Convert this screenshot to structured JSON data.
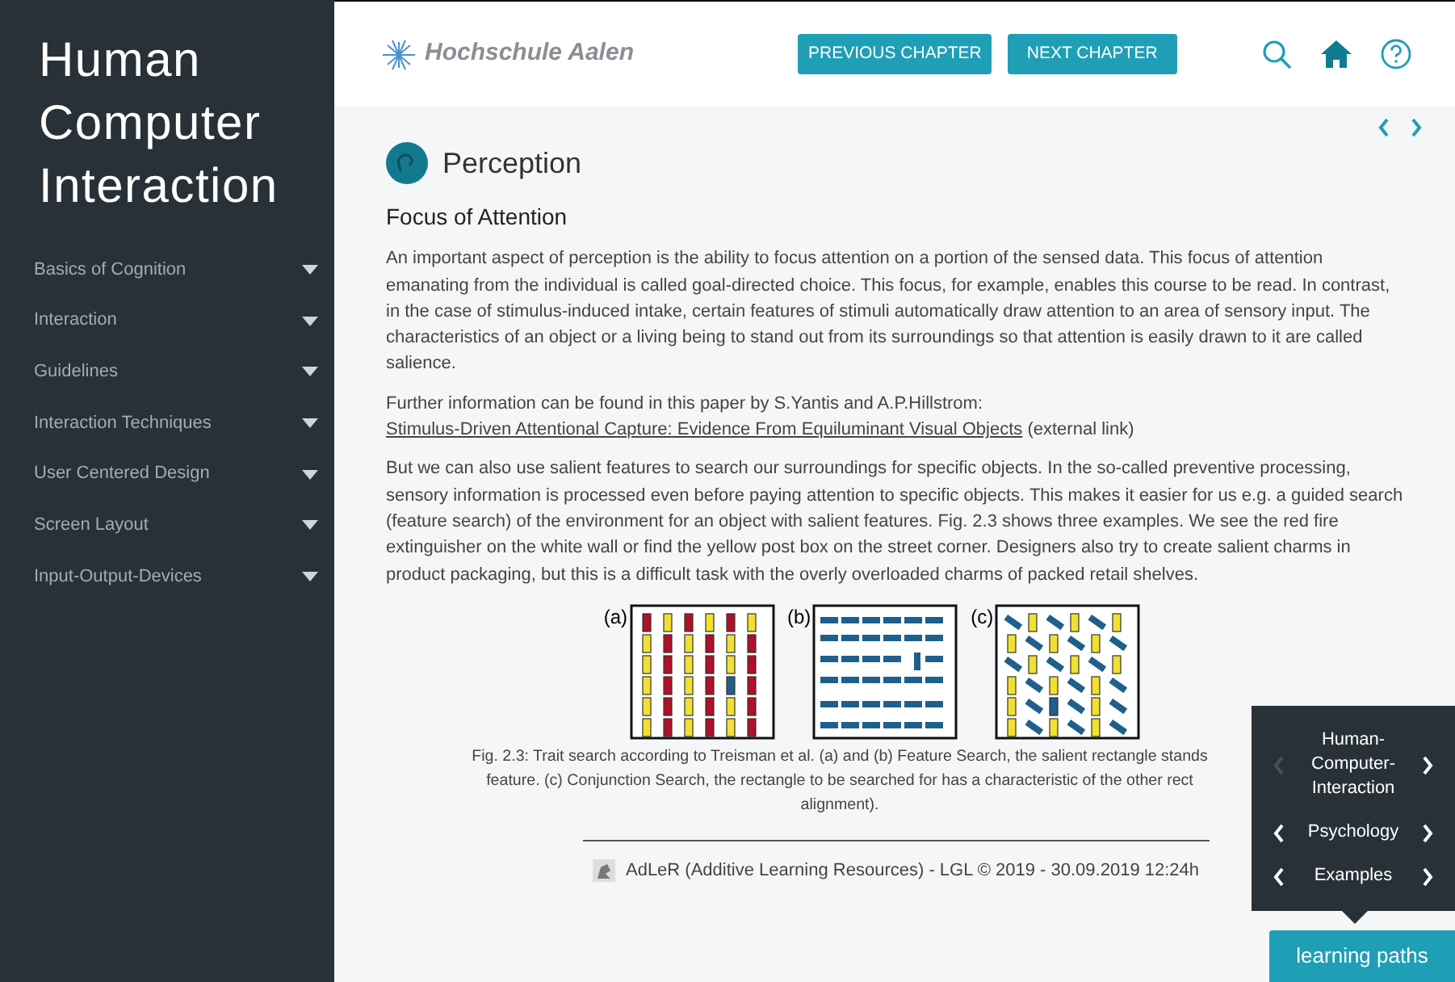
{
  "sidebar": {
    "title": "Human Computer Interaction",
    "items": [
      {
        "label": "Basics of Cognition",
        "expanded": false
      },
      {
        "label": "Interaction",
        "expanded": false
      },
      {
        "label": "Guidelines",
        "expanded": false
      },
      {
        "label": "Interaction Techniques",
        "expanded": false
      },
      {
        "label": "User Centered Design",
        "expanded": false
      },
      {
        "label": "Screen Layout",
        "expanded": false
      },
      {
        "label": "Input-Output-Devices",
        "expanded": false
      }
    ]
  },
  "header": {
    "logo": "Hochschule Aalen",
    "buttons": [
      "PREVIOUS CHAPTER",
      "NEXT CHAPTER"
    ]
  },
  "page": {
    "chapter": "Perception",
    "section": "Focus of Attention",
    "paragraph_1": "An important aspect of perception is the ability to focus attention on a portion of the sensed data. This focus of attention emanating from the individual is called goal-directed choice. This focus, for example, enables this course to be read. In contrast, in the case of stimulus-induced intake, certain features of stimuli automatically draw attention to an area of sensory input. The characteristics of an object or a living being to stand out from its surroundings so that attention is easily drawn to it are called salience.",
    "paragraph_2": {
      "text": "Further information can be found in this paper by S.Yantis and A.P.Hillstrom:",
      "link": "Stimulus-Driven Attentional Capture: Evidence From Equiluminant Visual Objects",
      "suffix": "(external link)"
    },
    "paragraph_3": "But we can also use salient features to search our surroundings for specific objects. In the so-called preventive processing, sensory information is processed even before paying attention to specific objects. This makes it easier for us e.g. a guided search (feature search) of the environment for an object with salient features. Fig. 2.3 shows three examples. We see the red fire extinguisher on the white wall or find the yellow post box on the street corner. Designers also try to create salient charms in product packaging, but this is a difficult task with the overly overloaded charms of packed retail shelves.",
    "figure": {
      "panels": [
        "(a)",
        "(b)",
        "(c)"
      ],
      "caption": [
        "Fig. 2.3: Trait search according to Treisman et al. (a) and (b) Feature Search, the salient rectangle stands",
        "feature. (c) Conjunction Search, the rectangle to be searched for has a characteristic of the other rect",
        "alignment)."
      ]
    },
    "footer": "AdLeR (Additive Learning Resources) - LGL © 2019 - 30.09.2019 12:24h"
  },
  "learning_paths": {
    "levels": [
      {
        "label": "Human-\nComputer-\nInteraction",
        "prev_enabled": false
      },
      {
        "label": "Psychology",
        "prev_enabled": true
      },
      {
        "label": "Examples",
        "prev_enabled": true
      }
    ],
    "button": "learning paths"
  }
}
